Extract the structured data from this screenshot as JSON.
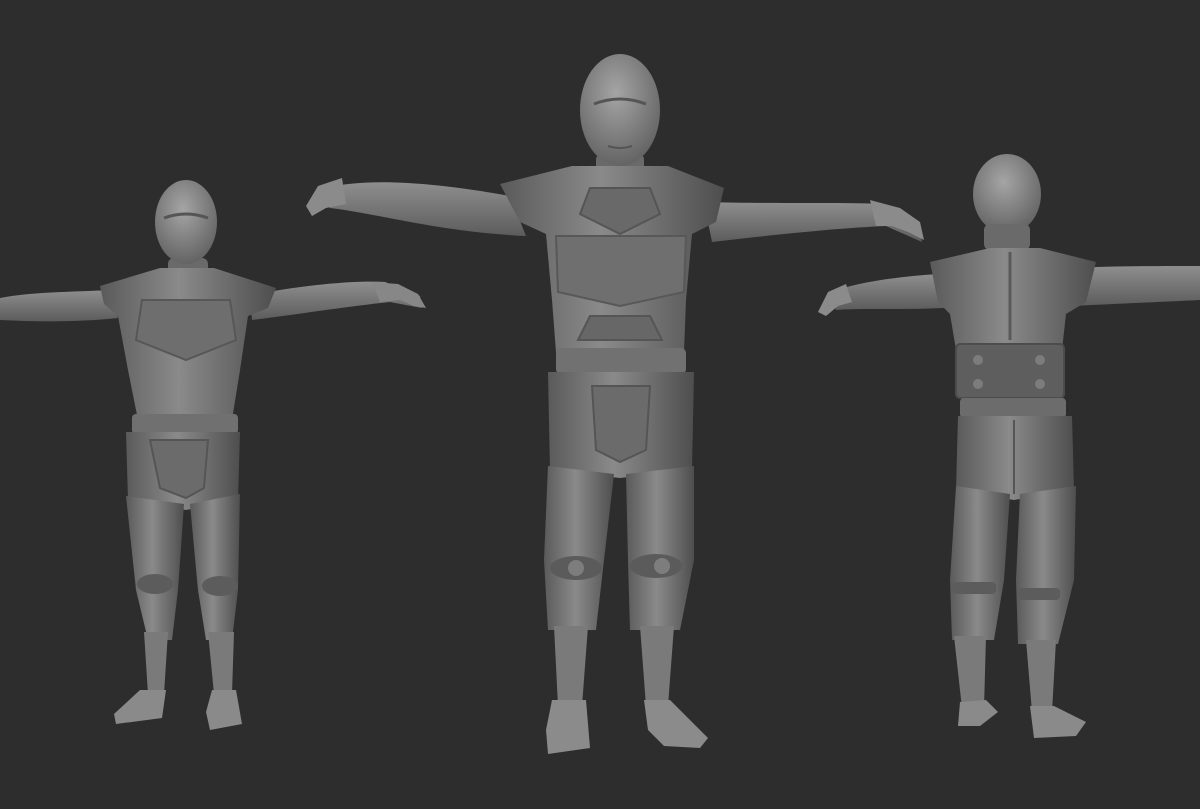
{
  "scene": {
    "background_color": "#2d2d2d",
    "model_color": "#7b7b7b",
    "model_shadow_color": "#555555",
    "model_highlight_color": "#a3a3a3",
    "figures": [
      {
        "view": "front-three-quarter",
        "pose": "t-pose"
      },
      {
        "view": "front",
        "pose": "t-pose"
      },
      {
        "view": "back",
        "pose": "t-pose"
      }
    ]
  }
}
